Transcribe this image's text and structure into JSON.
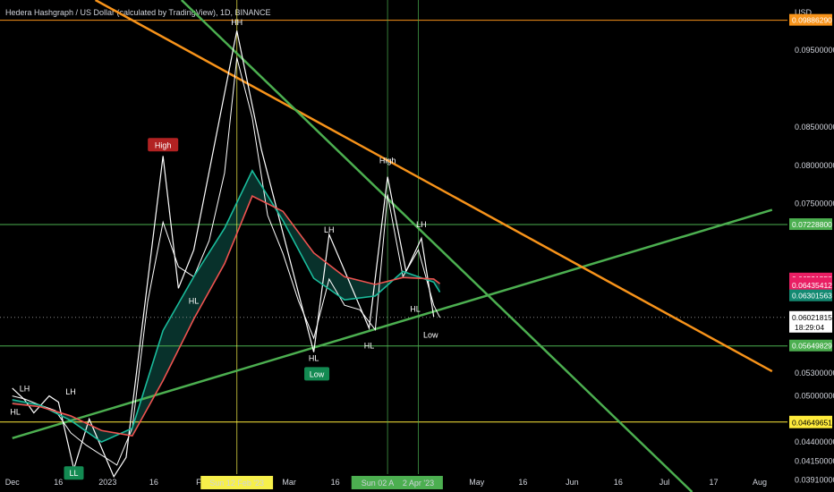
{
  "header": {
    "title": "Hedera Hashgraph / US Dollar (calculated by TradingView), 1D, BINANCE",
    "currency": "USD"
  },
  "chart_data": {
    "type": "line",
    "title": "Hedera Hashgraph / US Dollar (calculated by TradingView), 1D, BINANCE",
    "ylim": [
      0.0375,
      0.1015
    ],
    "grid": false,
    "y_ticks": [
      "0.09500000",
      "0.08500000",
      "0.08000000",
      "0.07500000",
      "0.05300000",
      "0.05000000",
      "0.04400000",
      "0.04150000",
      "0.03910000"
    ],
    "x_ticks": [
      {
        "label": "Dec",
        "x": "2022-12-01"
      },
      {
        "label": "16",
        "x": "2022-12-16"
      },
      {
        "label": "2023",
        "x": "2023-01-01"
      },
      {
        "label": "16",
        "x": "2023-01-16"
      },
      {
        "label": "Feb",
        "x": "2023-02-01"
      },
      {
        "label": "Mar",
        "x": "2023-03-01"
      },
      {
        "label": "16",
        "x": "2023-03-16"
      },
      {
        "label": "May",
        "x": "2023-05-01"
      },
      {
        "label": "16",
        "x": "2023-05-16"
      },
      {
        "label": "Jun",
        "x": "2023-06-01"
      },
      {
        "label": "16",
        "x": "2023-06-16"
      },
      {
        "label": "Jul",
        "x": "2023-07-01"
      },
      {
        "label": "17",
        "x": "2023-07-17"
      },
      {
        "label": "Aug",
        "x": "2023-08-01"
      }
    ],
    "date_highlights": [
      {
        "label": "Sun 12 Feb '23",
        "x": "2023-02-12",
        "color": "#f7f04a",
        "text_color": "#000000"
      },
      {
        "label": "Sun 02 Apr '23",
        "x": "2023-04-02",
        "color": "#4caf50",
        "text_color": "#ffffff"
      },
      {
        "label": "2 Apr '23",
        "x": "2023-04-12",
        "color": "#4caf50",
        "text_color": "#ffffff"
      }
    ],
    "price_tags": [
      {
        "value": 0.0988629,
        "text": "0.09886290",
        "bg": "#f7931a",
        "fg": "#ffffff"
      },
      {
        "value": 0.072288,
        "text": "0.07228800",
        "bg": "#4caf50",
        "fg": "#ffffff"
      },
      {
        "value": 0.06521558,
        "text": "0.06521558",
        "bg": "#e91e63",
        "fg": "#ffffff"
      },
      {
        "value": 0.06461113,
        "text": "0.06461113",
        "bg": "#e91e63",
        "fg": "#ffffff"
      },
      {
        "value": 0.06435412,
        "text": "0.06435412",
        "bg": "#e91e63",
        "fg": "#ffffff"
      },
      {
        "value": 0.06301563,
        "text": "0.06301563",
        "bg": "#138a72",
        "fg": "#ffffff"
      },
      {
        "value": 0.06021815,
        "text": "0.06021815",
        "bg": "#ffffff",
        "fg": "#000000",
        "sub": "18:29:04"
      },
      {
        "value": 0.05649829,
        "text": "0.05649829",
        "bg": "#4caf50",
        "fg": "#ffffff"
      },
      {
        "value": 0.04659925,
        "text": "0.04659925",
        "bg": "#ffeb3b",
        "fg": "#000000"
      },
      {
        "value": 0.04649651,
        "text": "0.04649651",
        "bg": "#ffeb3b",
        "fg": "#000000"
      }
    ],
    "level_lines": [
      {
        "value": 0.0988629,
        "color": "#f7931a"
      },
      {
        "value": 0.072288,
        "color": "#4caf50"
      },
      {
        "value": 0.05649829,
        "color": "#4caf50"
      },
      {
        "value": 0.0466,
        "color": "#ffeb3b"
      }
    ],
    "trend_lines": [
      {
        "x1": "2022-12-01",
        "y1": 0.0445,
        "x2": "2023-08-05",
        "y2": 0.0742,
        "color": "#4caf50",
        "role": "ascending support"
      },
      {
        "x1": "2022-12-28",
        "y1": 0.1015,
        "x2": "2023-08-05",
        "y2": 0.0532,
        "color": "#f7931a",
        "role": "descending resistance"
      },
      {
        "x1": "2023-01-25",
        "y1": 0.1015,
        "x2": "2023-07-10",
        "y2": 0.0375,
        "color": "#4caf50",
        "role": "descending resistance"
      }
    ],
    "structure_labels": [
      {
        "text": "HH",
        "x": "2023-02-12",
        "y": 0.0985,
        "color": "#ffffff"
      },
      {
        "text": "High",
        "x": "2023-01-19",
        "y": 0.0825,
        "color": "#ffffff",
        "badge": "#b22222"
      },
      {
        "text": "High",
        "x": "2023-04-02",
        "y": 0.0805,
        "color": "#ffffff"
      },
      {
        "text": "LH",
        "x": "2022-12-05",
        "y": 0.0508,
        "color": "#ffffff"
      },
      {
        "text": "LH",
        "x": "2022-12-20",
        "y": 0.0504,
        "color": "#ffffff"
      },
      {
        "text": "LH",
        "x": "2023-03-14",
        "y": 0.0715,
        "color": "#ffffff"
      },
      {
        "text": "LH",
        "x": "2023-04-13",
        "y": 0.0722,
        "color": "#ffffff"
      },
      {
        "text": "HL",
        "x": "2022-12-02",
        "y": 0.0478,
        "color": "#ffffff"
      },
      {
        "text": "HL",
        "x": "2023-01-29",
        "y": 0.0622,
        "color": "#ffffff"
      },
      {
        "text": "HL",
        "x": "2023-03-09",
        "y": 0.0548,
        "color": "#ffffff"
      },
      {
        "text": "HL",
        "x": "2023-03-27",
        "y": 0.0564,
        "color": "#ffffff"
      },
      {
        "text": "HL",
        "x": "2023-04-11",
        "y": 0.0612,
        "color": "#ffffff"
      },
      {
        "text": "Low",
        "x": "2023-04-16",
        "y": 0.0578,
        "color": "#ffffff"
      },
      {
        "text": "Low",
        "x": "2023-03-10",
        "y": 0.0527,
        "color": "#ffffff",
        "badge": "#138a52"
      },
      {
        "text": "LL",
        "x": "2022-12-21",
        "y": 0.0398,
        "color": "#ffffff",
        "badge": "#138a52"
      }
    ],
    "zigzag": {
      "x": [
        "2022-12-01",
        "2022-12-05",
        "2022-12-08",
        "2022-12-13",
        "2022-12-16",
        "2022-12-21",
        "2022-12-26",
        "2023-01-03",
        "2023-01-07",
        "2023-01-19",
        "2023-01-24",
        "2023-01-29",
        "2023-02-12",
        "2023-02-20",
        "2023-03-09",
        "2023-03-14",
        "2023-03-27",
        "2023-04-02",
        "2023-04-08",
        "2023-04-13",
        "2023-04-17"
      ],
      "y": [
        0.051,
        0.0495,
        0.0478,
        0.05,
        0.0492,
        0.0405,
        0.047,
        0.0395,
        0.042,
        0.0812,
        0.064,
        0.069,
        0.0975,
        0.082,
        0.0557,
        0.071,
        0.0588,
        0.0785,
        0.0662,
        0.0705,
        0.0603
      ]
    },
    "series": [
      {
        "color": "#ffffff",
        "x": [
          "2022-12-01",
          "2022-12-05",
          "2022-12-10",
          "2022-12-15",
          "2022-12-20",
          "2022-12-25",
          "2022-12-30",
          "2023-01-04",
          "2023-01-09",
          "2023-01-14",
          "2023-01-19",
          "2023-01-24",
          "2023-01-29",
          "2023-02-03",
          "2023-02-08",
          "2023-02-12",
          "2023-02-17",
          "2023-02-22",
          "2023-02-27",
          "2023-03-04",
          "2023-03-09",
          "2023-03-14",
          "2023-03-19",
          "2023-03-24",
          "2023-03-29",
          "2023-04-02",
          "2023-04-07",
          "2023-04-12",
          "2023-04-17",
          "2023-04-19"
        ],
        "y": [
          0.05,
          0.0496,
          0.0488,
          0.0481,
          0.0452,
          0.0436,
          0.0423,
          0.041,
          0.0458,
          0.0622,
          0.0726,
          0.0668,
          0.0655,
          0.0702,
          0.079,
          0.094,
          0.0862,
          0.0735,
          0.0685,
          0.0624,
          0.0575,
          0.0652,
          0.0618,
          0.0612,
          0.0586,
          0.0762,
          0.0655,
          0.069,
          0.0618,
          0.0602
        ]
      },
      {
        "color": "#1abc9c",
        "x": [
          "2022-12-01",
          "2022-12-10",
          "2022-12-20",
          "2022-12-30",
          "2023-01-09",
          "2023-01-19",
          "2023-01-29",
          "2023-02-08",
          "2023-02-17",
          "2023-02-27",
          "2023-03-09",
          "2023-03-19",
          "2023-03-29",
          "2023-04-07",
          "2023-04-17",
          "2023-04-19"
        ],
        "y": [
          0.0495,
          0.0488,
          0.0468,
          0.044,
          0.0458,
          0.0585,
          0.0655,
          0.0718,
          0.0793,
          0.0728,
          0.0653,
          0.0625,
          0.063,
          0.0662,
          0.0648,
          0.0635
        ]
      },
      {
        "color": "#ef5350",
        "x": [
          "2022-12-01",
          "2022-12-10",
          "2022-12-20",
          "2022-12-30",
          "2023-01-09",
          "2023-01-19",
          "2023-01-29",
          "2023-02-08",
          "2023-02-17",
          "2023-02-27",
          "2023-03-09",
          "2023-03-19",
          "2023-03-29",
          "2023-04-07",
          "2023-04-17",
          "2023-04-19"
        ],
        "y": [
          0.049,
          0.0486,
          0.0474,
          0.0455,
          0.0448,
          0.052,
          0.06,
          0.0672,
          0.076,
          0.074,
          0.0686,
          0.0655,
          0.0645,
          0.0654,
          0.0652,
          0.0646
        ]
      }
    ]
  }
}
